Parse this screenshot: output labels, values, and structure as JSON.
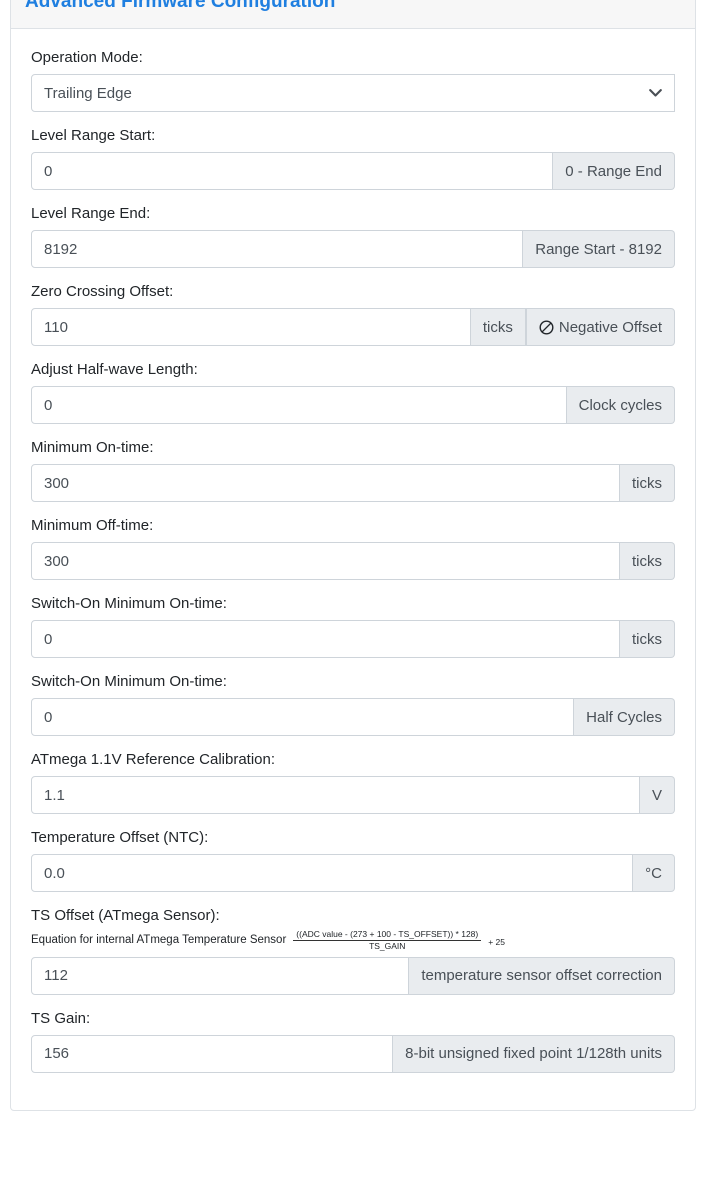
{
  "card": {
    "title": "Advanced Firmware Configuration"
  },
  "fields": [
    {
      "id": "operation-mode",
      "label": "Operation Mode:",
      "type": "select",
      "value": "Trailing Edge",
      "options": [
        "Trailing Edge"
      ],
      "icon": "chevron-down-icon"
    },
    {
      "id": "level-range-start",
      "label": "Level Range Start:",
      "type": "input",
      "value": "0",
      "addons": [
        "0 - Range End"
      ]
    },
    {
      "id": "level-range-end",
      "label": "Level Range End:",
      "type": "input",
      "value": "8192",
      "addons": [
        "Range Start - 8192"
      ]
    },
    {
      "id": "zero-crossing-offset",
      "label": "Zero Crossing Offset:",
      "type": "input",
      "value": "110",
      "addons": [
        "ticks",
        "Negative Offset"
      ],
      "addon_icon": "ban-icon"
    },
    {
      "id": "adjust-half-wave-length",
      "label": "Adjust Half-wave Length:",
      "type": "input",
      "value": "0",
      "addons": [
        "Clock cycles"
      ]
    },
    {
      "id": "minimum-on-time",
      "label": "Minimum On-time:",
      "type": "input",
      "value": "300",
      "addons": [
        "ticks"
      ]
    },
    {
      "id": "minimum-off-time",
      "label": "Minimum Off-time:",
      "type": "input",
      "value": "300",
      "addons": [
        "ticks"
      ]
    },
    {
      "id": "switch-on-minimum-on-time-ticks",
      "label": "Switch-On Minimum On-time:",
      "type": "input",
      "value": "0",
      "addons": [
        "ticks"
      ]
    },
    {
      "id": "switch-on-minimum-on-time-half-cycles",
      "label": "Switch-On Minimum On-time:",
      "type": "input",
      "value": "0",
      "addons": [
        "Half Cycles"
      ]
    },
    {
      "id": "atmega-reference-calibration",
      "label": "ATmega 1.1V Reference Calibration:",
      "type": "input",
      "value": "1.1",
      "addons": [
        "V"
      ]
    },
    {
      "id": "temperature-offset-ntc",
      "label": "Temperature Offset (NTC):",
      "type": "input",
      "value": "0.0",
      "addons": [
        "°C"
      ]
    },
    {
      "id": "ts-offset",
      "label": "TS Offset (ATmega Sensor):",
      "type": "input",
      "value": "112",
      "addons": [
        "temperature sensor offset correction"
      ],
      "equation": {
        "prefix": "Equation for internal ATmega Temperature Sensor",
        "numerator": "((ADC value - (273 + 100 - TS_OFFSET)) * 128)",
        "denominator": "TS_GAIN",
        "tail": "+ 25"
      }
    },
    {
      "id": "ts-gain",
      "label": "TS Gain:",
      "type": "input",
      "value": "156",
      "addons": [
        "8-bit unsigned fixed point 1/128th units"
      ]
    }
  ],
  "colors": {
    "title": "#1f7fe0",
    "addon_bg": "#e9ecef",
    "border": "#ced4da",
    "value_text": "#495057"
  }
}
